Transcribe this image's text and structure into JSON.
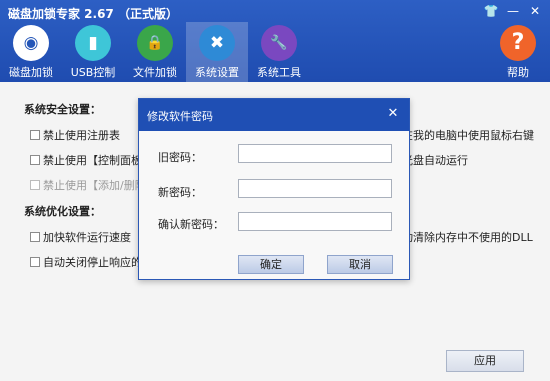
{
  "window": {
    "title": "磁盘加锁专家 2.67 （正式版）",
    "controls": [
      "👕",
      "—",
      "✕"
    ]
  },
  "nav": [
    {
      "label": "磁盘加锁",
      "icon": "disk-lock-icon",
      "glyph": "◉",
      "color": "#ffffff",
      "active": false
    },
    {
      "label": "USB控制",
      "icon": "usb-icon",
      "glyph": "▮",
      "color": "#3ec6d8",
      "active": false
    },
    {
      "label": "文件加锁",
      "icon": "file-lock-icon",
      "glyph": "🔒",
      "color": "#3aa64a",
      "active": false
    },
    {
      "label": "系统设置",
      "icon": "tools-icon",
      "glyph": "✖",
      "color": "#2e8ad6",
      "active": true
    },
    {
      "label": "系统工具",
      "icon": "screwdriver-icon",
      "glyph": "🔧",
      "color": "#7a48c0",
      "active": false
    }
  ],
  "help": {
    "label": "帮助",
    "glyph": "?"
  },
  "security": {
    "title": "系统安全设置：",
    "items": [
      {
        "label": "禁止使用注册表",
        "disabled": false
      },
      {
        "label": "禁止使用【控制面板】",
        "disabled": false
      },
      {
        "label": "禁止使用【添加/删除程",
        "disabled": true
      }
    ],
    "right_items": [
      {
        "label": "在我的电脑中使用鼠标右键"
      },
      {
        "label": "光盘自动运行"
      }
    ]
  },
  "optimize": {
    "title": "系统优化设置：",
    "items": [
      {
        "label": "加快软件运行速度"
      },
      {
        "label": "自动关闭停止响应的程"
      }
    ],
    "right_items": [
      {
        "label": "动清除内存中不使用的DLL"
      }
    ]
  },
  "apply_label": "应用",
  "dialog": {
    "title": "修改软件密码",
    "old_label": "旧密码：",
    "new_label": "新密码：",
    "confirm_label": "确认新密码：",
    "ok_label": "确定",
    "cancel_label": "取消"
  }
}
